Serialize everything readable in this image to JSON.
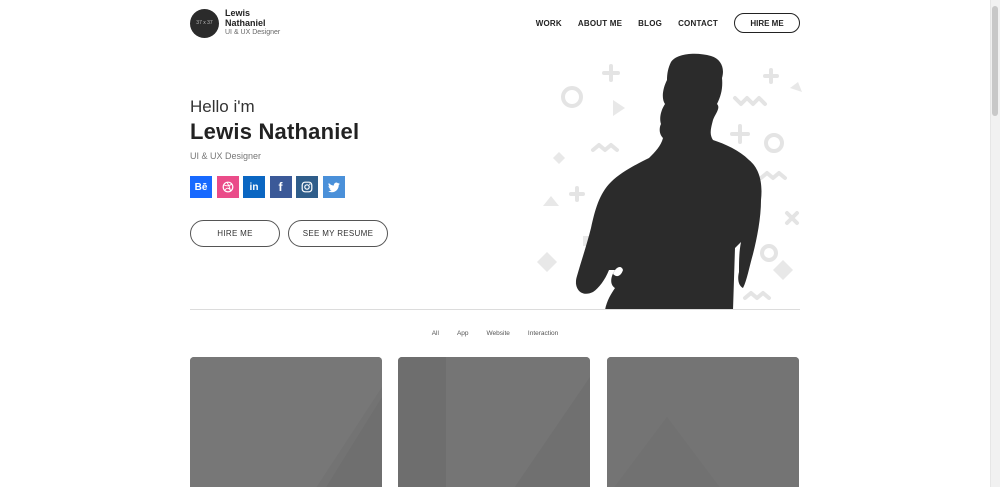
{
  "brand": {
    "avatar_text": "37 x 37",
    "name": "Lewis Nathaniel",
    "role": "UI & UX Designer"
  },
  "nav": {
    "items": [
      "WORK",
      "ABOUT ME",
      "BLOG",
      "CONTACT"
    ],
    "hire_label": "HIRE ME"
  },
  "hero": {
    "greeting": "Hello i'm",
    "name": "Lewis Nathaniel",
    "role": "UI & UX Designer",
    "socials": [
      {
        "icon": "behance-icon",
        "glyph": "Bē",
        "color": "#1769ff"
      },
      {
        "icon": "dribbble-icon",
        "glyph": "◎",
        "color": "#ea4c89"
      },
      {
        "icon": "linkedin-icon",
        "glyph": "in",
        "color": "#0a66c2"
      },
      {
        "icon": "facebook-icon",
        "glyph": "f",
        "color": "#3b5998"
      },
      {
        "icon": "instagram-icon",
        "glyph": "◻",
        "color": "#2f5d8a"
      },
      {
        "icon": "twitter-icon",
        "glyph": "🐦",
        "color": "#4a90d9"
      }
    ],
    "cta_primary": "HIRE ME",
    "cta_secondary": "SEE MY RESUME"
  },
  "filters": [
    "All",
    "App",
    "Website",
    "Interaction"
  ],
  "colors": {
    "silhouette": "#2b2b2b",
    "decor": "#e6e6e6",
    "card": "#737373"
  }
}
